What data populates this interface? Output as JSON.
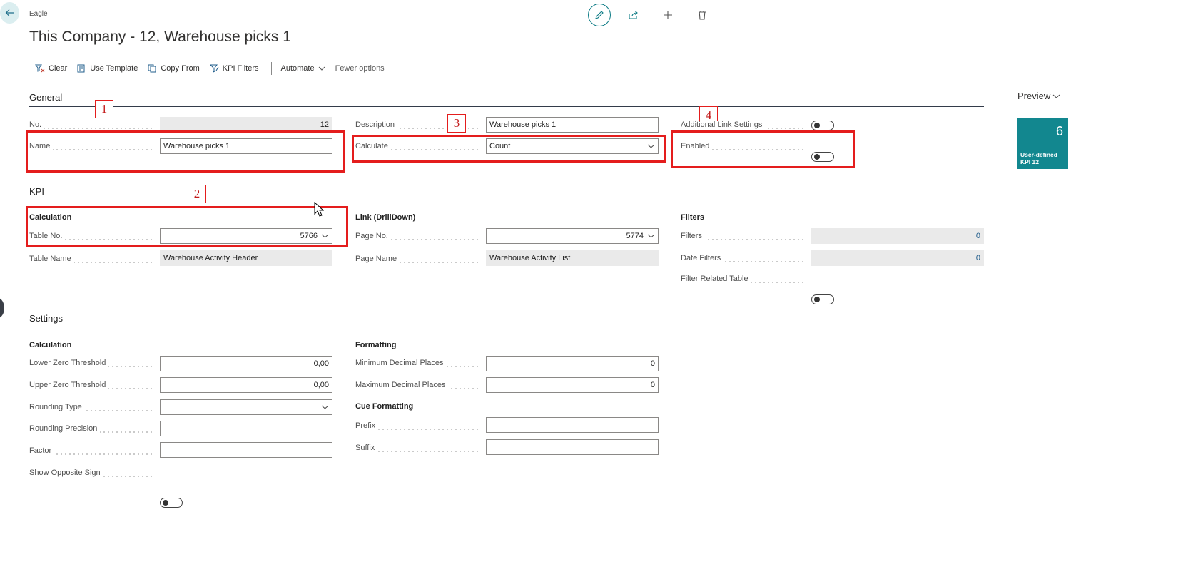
{
  "header": {
    "breadcrumb": "Eagle",
    "title": "This Company - 12, Warehouse picks 1"
  },
  "toolbar": {
    "clear": "Clear",
    "use_template": "Use Template",
    "copy_from": "Copy From",
    "kpi_filters": "KPI Filters",
    "automate": "Automate",
    "fewer_options": "Fewer options"
  },
  "general": {
    "title": "General",
    "no_label": "No.",
    "no_value": "12",
    "name_label": "Name",
    "name_value": "Warehouse picks 1",
    "description_label": "Description",
    "description_value": "Warehouse picks 1",
    "calculate_label": "Calculate",
    "calculate_value": "Count",
    "additional_link_label": "Additional Link Settings",
    "enabled_label": "Enabled"
  },
  "kpi": {
    "title": "KPI",
    "calculation_title": "Calculation",
    "table_no_label": "Table No.",
    "table_no_value": "5766",
    "table_name_label": "Table Name",
    "table_name_value": "Warehouse Activity Header",
    "link_title": "Link (DrillDown)",
    "page_no_label": "Page No.",
    "page_no_value": "5774",
    "page_name_label": "Page Name",
    "page_name_value": "Warehouse Activity List",
    "filters_title": "Filters",
    "filters_label": "Filters",
    "filters_value": "0",
    "date_filters_label": "Date Filters",
    "date_filters_value": "0",
    "filter_related_label": "Filter Related Table"
  },
  "settings": {
    "title": "Settings",
    "calculation_title": "Calculation",
    "lower_zero_label": "Lower Zero Threshold",
    "lower_zero_value": "0,00",
    "upper_zero_label": "Upper Zero Threshold",
    "upper_zero_value": "0,00",
    "rounding_type_label": "Rounding Type",
    "rounding_type_value": "",
    "rounding_precision_label": "Rounding Precision",
    "rounding_precision_value": "",
    "factor_label": "Factor",
    "factor_value": "",
    "show_opposite_label": "Show Opposite Sign",
    "formatting_title": "Formatting",
    "min_decimal_label": "Minimum Decimal Places",
    "min_decimal_value": "0",
    "max_decimal_label": "Maximum Decimal Places",
    "max_decimal_value": "0",
    "cue_formatting_title": "Cue Formatting",
    "prefix_label": "Prefix",
    "prefix_value": "",
    "suffix_label": "Suffix",
    "suffix_value": ""
  },
  "preview": {
    "title": "Preview",
    "tile_value": "6",
    "tile_label_1": "User-defined",
    "tile_label_2": "KPI 12"
  },
  "annotations": {
    "m1": "1",
    "m2": "2",
    "m3": "3",
    "m4": "4"
  },
  "colors": {
    "accent": "#0e7c86",
    "tile": "#12878f",
    "annotation": "#e41d1d"
  }
}
